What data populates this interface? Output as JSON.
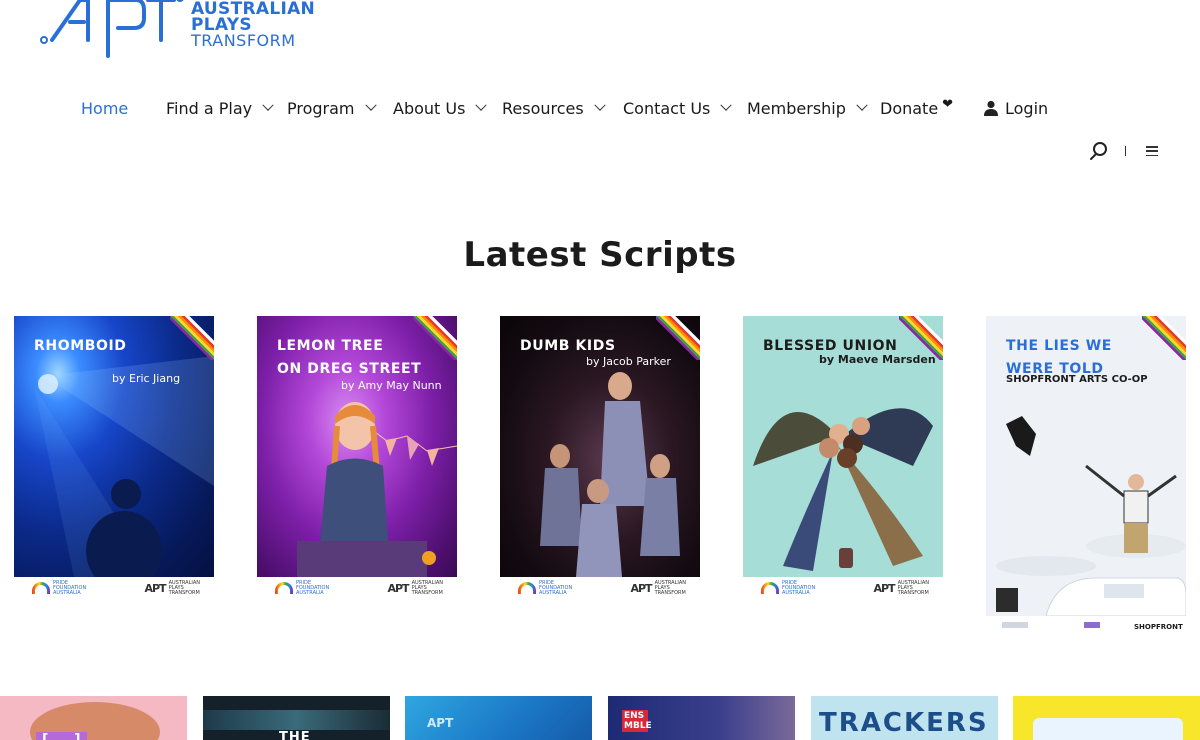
{
  "brand": {
    "line1": "AUSTRALIAN",
    "line2": "PLAYS",
    "line3": "TRANSFORM",
    "accent": "#2a6fd6"
  },
  "nav": {
    "items": [
      {
        "label": "Home",
        "active": true
      },
      {
        "label": "Find a Play",
        "dropdown": true
      },
      {
        "label": "Program",
        "dropdown": true
      },
      {
        "label": "About Us",
        "dropdown": true
      },
      {
        "label": "Resources",
        "dropdown": true
      },
      {
        "label": "Contact Us",
        "dropdown": true
      },
      {
        "label": "Membership",
        "dropdown": true
      },
      {
        "label": "Donate",
        "icon": "heart-icon"
      },
      {
        "label": "Login",
        "icon": "person-icon"
      }
    ]
  },
  "utility": {
    "search_icon": "search-icon",
    "menu_icon": "hamburger-icon"
  },
  "section": {
    "title": "Latest Scripts"
  },
  "scripts": [
    {
      "title_lines": [
        "RHOMBOID"
      ],
      "byline": "by Eric Jiang"
    },
    {
      "title_lines": [
        "LEMON TREE",
        "ON DREG STREET"
      ],
      "byline": "by Amy May Nunn"
    },
    {
      "title_lines": [
        "DUMB KIDS"
      ],
      "byline": "by Jacob Parker"
    },
    {
      "title_lines": [
        "BLESSED UNION"
      ],
      "byline": "by Maeve Marsden"
    },
    {
      "title_lines": [
        "THE LIES WE",
        "WERE TOLD"
      ],
      "byline": "SHOPFRONT ARTS CO-OP"
    }
  ],
  "footer_logos": {
    "pride": [
      "PRIDE",
      "FOUNDATION",
      "AUSTRALIA"
    ],
    "apt": [
      "AUSTRALIAN",
      "PLAYS",
      "TRANSFORM"
    ],
    "shopfront": "SHOPFRONT"
  },
  "bottom_tiles": [
    {
      "text": "[ ... ]"
    },
    {
      "text": "THE"
    },
    {
      "text": ""
    },
    {
      "text": "ENS MBLE"
    },
    {
      "text": "TRACKERS"
    },
    {
      "text": ""
    }
  ]
}
